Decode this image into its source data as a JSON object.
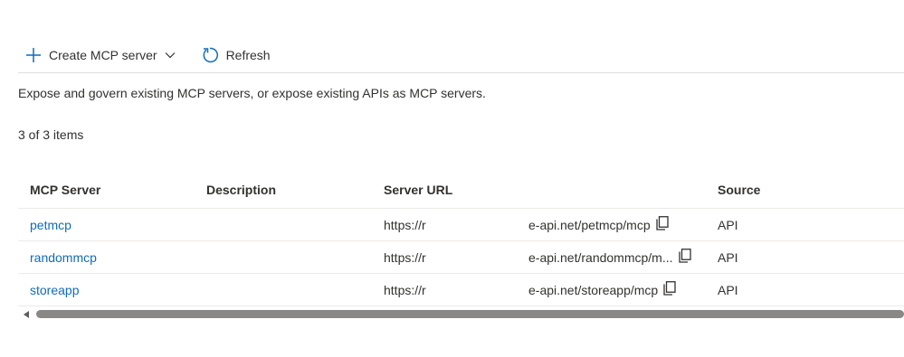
{
  "toolbar": {
    "create_label": "Create MCP server",
    "refresh_label": "Refresh"
  },
  "page": {
    "description": "Expose and govern existing MCP servers, or expose existing APIs as MCP servers.",
    "item_count": "3 of 3 items"
  },
  "table": {
    "columns": [
      "MCP Server",
      "Description",
      "Server URL",
      "Source"
    ],
    "rows": [
      {
        "name": "petmcp",
        "description": "",
        "url_prefix": "https://r",
        "url_suffix": "e-api.net/petmcp/mcp",
        "source": "API"
      },
      {
        "name": "randommcp",
        "description": "",
        "url_prefix": "https://r",
        "url_suffix": "e-api.net/randommcp/m...",
        "source": "API"
      },
      {
        "name": "storeapp",
        "description": "",
        "url_prefix": "https://r",
        "url_suffix": "e-api.net/storeapp/mcp",
        "source": "API"
      }
    ]
  },
  "icons": {
    "create": "plus-icon",
    "chevron": "chevron-down-icon",
    "refresh": "refresh-icon",
    "copy": "copy-icon"
  },
  "colors": {
    "accent": "#0f6cbd",
    "text": "#323130",
    "scrollbar": "#8a8886"
  }
}
